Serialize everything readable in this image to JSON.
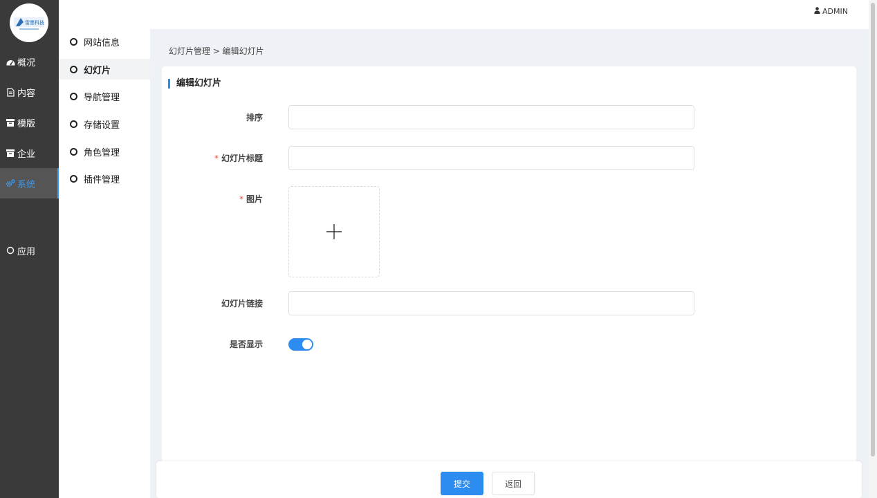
{
  "brand": {
    "logo_text": "雷墨科技",
    "accent_color": "#2d8cf0"
  },
  "header": {
    "user_label": "ADMIN",
    "user_icon": "user-icon"
  },
  "sidebar": {
    "items": [
      {
        "label": "概况",
        "icon": "dashboard-icon"
      },
      {
        "label": "内容",
        "icon": "document-icon"
      },
      {
        "label": "模版",
        "icon": "archive-icon"
      },
      {
        "label": "企业",
        "icon": "archive-icon"
      },
      {
        "label": "系统",
        "icon": "gears-icon",
        "active": true
      },
      {
        "label": "应用",
        "icon": "circle-icon"
      }
    ]
  },
  "submenu": {
    "items": [
      {
        "label": "网站信息"
      },
      {
        "label": "幻灯片",
        "active": true
      },
      {
        "label": "导航管理"
      },
      {
        "label": "存储设置"
      },
      {
        "label": "角色管理"
      },
      {
        "label": "插件管理"
      }
    ]
  },
  "breadcrumb": "幻灯片管理 > 编辑幻灯片",
  "form": {
    "title": "编辑幻灯片",
    "fields": {
      "sort": {
        "label": "排序",
        "value": "",
        "required": false
      },
      "slide_title": {
        "label": "幻灯片标题",
        "value": "",
        "required": true
      },
      "image": {
        "label": "图片",
        "required": true,
        "upload_icon": "plus-icon"
      },
      "link": {
        "label": "幻灯片链接",
        "value": "",
        "required": false
      },
      "visible": {
        "label": "是否显示",
        "on": true
      }
    },
    "required_mark": "*"
  },
  "footer": {
    "submit_label": "提交",
    "back_label": "返回"
  }
}
